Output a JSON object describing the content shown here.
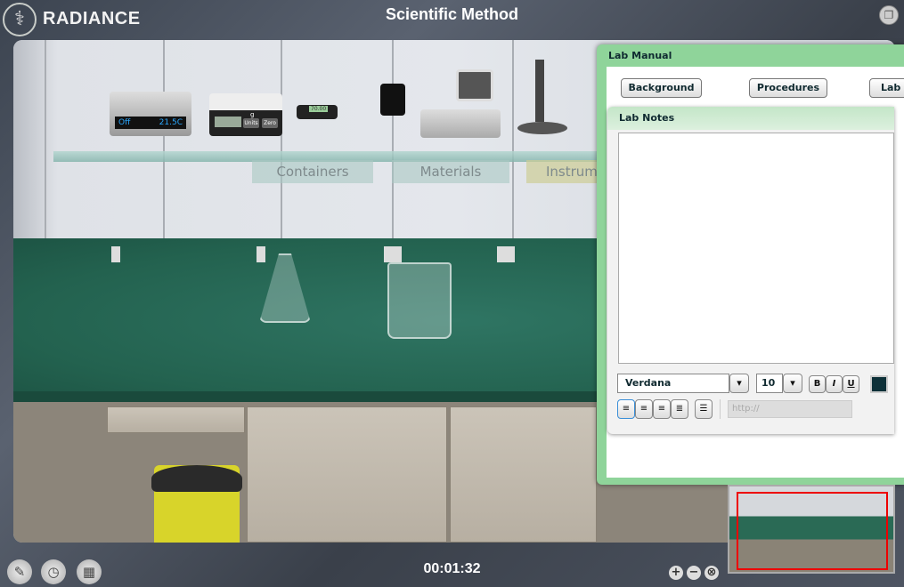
{
  "app": {
    "brand": "RADIANCE",
    "title": "Scientific Method"
  },
  "shelf": {
    "tabs": [
      {
        "label": "Containers"
      },
      {
        "label": "Materials"
      },
      {
        "label": "Instrum"
      }
    ],
    "water_bath": {
      "state": "Off",
      "temperature": "21.5C"
    },
    "balance": {
      "unit": "g",
      "buttons": [
        "Units",
        "Zero"
      ]
    },
    "meter_reading": "70.00"
  },
  "lab_manual": {
    "title": "Lab Manual",
    "buttons": [
      "Background",
      "Procedures",
      "Lab I"
    ],
    "notes": {
      "title": "Lab Notes",
      "content": "",
      "font": "Verdana",
      "font_size": "10",
      "format": {
        "bold": "B",
        "italic": "I",
        "underline": "U"
      },
      "text_color": "#0d3038",
      "link_placeholder": "http://",
      "align_active": "left"
    }
  },
  "footer": {
    "timer": "00:01:32"
  },
  "colors": {
    "panel_green": "#8fd49a",
    "counter": "#2a6a55",
    "minimap_view": "#e00000"
  }
}
